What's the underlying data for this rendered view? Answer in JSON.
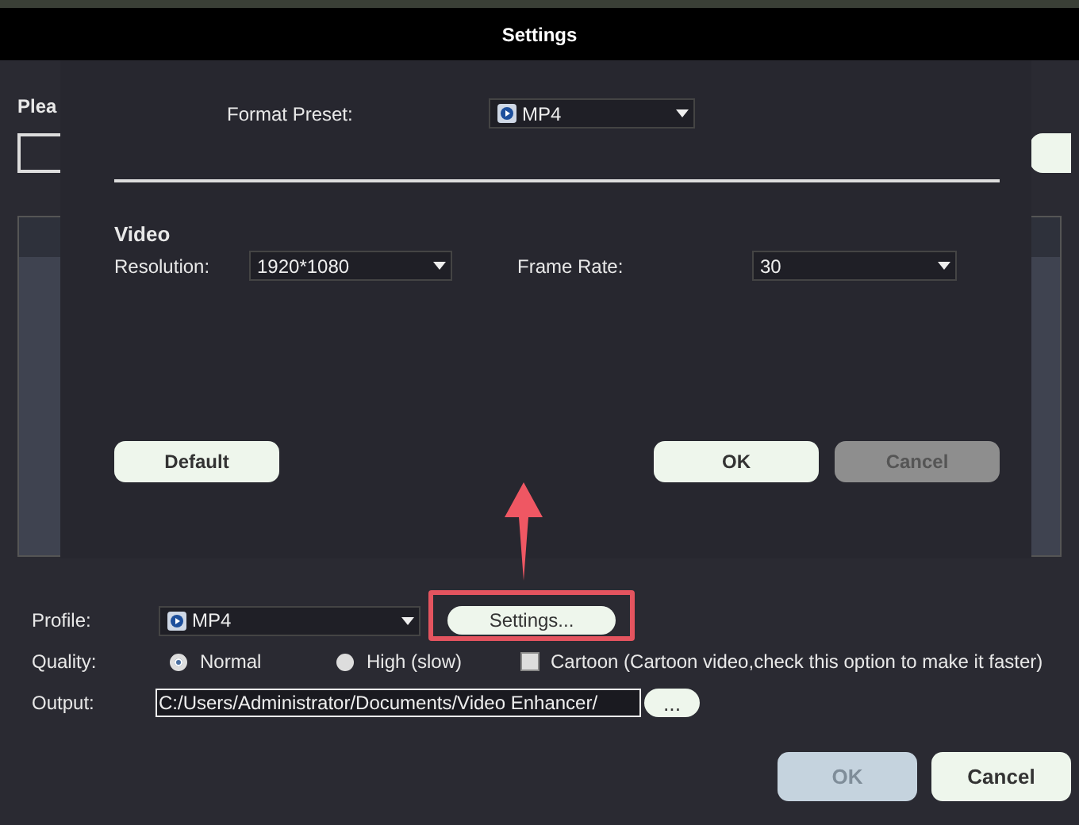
{
  "window": {
    "title": "Settings"
  },
  "background_dialog": {
    "heading": "Plea"
  },
  "preset_dialog": {
    "format_preset": {
      "label": "Format Preset:",
      "value": "MP4"
    },
    "section": "Video",
    "resolution": {
      "label": "Resolution:",
      "value": "1920*1080"
    },
    "frame_rate": {
      "label": "Frame Rate:",
      "value": "30"
    },
    "buttons": [
      {
        "label": "Default",
        "disabled": false
      },
      {
        "label": "OK",
        "disabled": false
      },
      {
        "label": "Cancel",
        "disabled": true
      }
    ]
  },
  "profile": {
    "label": "Profile:",
    "value": "MP4",
    "settings_button": "Settings..."
  },
  "quality": {
    "label": "Quality:",
    "options": [
      {
        "label": "Normal",
        "selected": true
      },
      {
        "label": "High (slow)",
        "selected": false
      }
    ],
    "cartoon": {
      "label": "Cartoon (Cartoon video,check this option to make it faster)",
      "checked": false
    }
  },
  "output": {
    "label": "Output:",
    "value": "C:/Users/Administrator/Documents/Video Enhancer/",
    "browse": "..."
  },
  "buttons": [
    {
      "label": "OK",
      "disabled": true
    },
    {
      "label": "Cancel",
      "disabled": false
    }
  ]
}
